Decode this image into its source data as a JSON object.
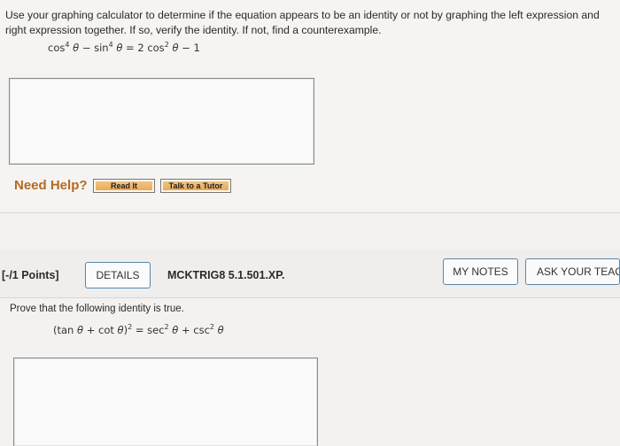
{
  "question1": {
    "prompt_line1": "Use your graphing calculator to determine if the equation appears to be an identity or not by graphing the left expression and",
    "prompt_line2": "right expression together. If so, verify the identity. If not, find a counterexample.",
    "equation": {
      "cos": "cos",
      "exp4a": "4",
      "theta": "θ",
      "minus": "−",
      "sin": "sin",
      "exp4b": "4",
      "equals": "=",
      "coef": "2",
      "cos2": "cos",
      "exp2": "2",
      "minus2": "−",
      "one": "1"
    },
    "need_help": "Need Help?",
    "read_it": "Read It",
    "talk_to_tutor": "Talk to a Tutor"
  },
  "question2": {
    "points": "[-/1 Points]",
    "details": "DETAILS",
    "code": "MCKTRIG8 5.1.501.XP.",
    "my_notes": "MY NOTES",
    "ask_teacher": "ASK YOUR TEACHER",
    "prompt": "Prove that the following identity is true.",
    "identity": {
      "open": "(tan",
      "theta": "θ",
      "plus": "+",
      "cot": "cot",
      "close": ")",
      "sq": "2",
      "equals": "=",
      "sec": "sec",
      "exp2a": "2",
      "plus2": "+",
      "csc": "csc",
      "exp2b": "2"
    }
  },
  "colors": {
    "need_help": "#b36a24",
    "button_orange": "#e9a552",
    "outline_blue": "#5a85a8"
  }
}
